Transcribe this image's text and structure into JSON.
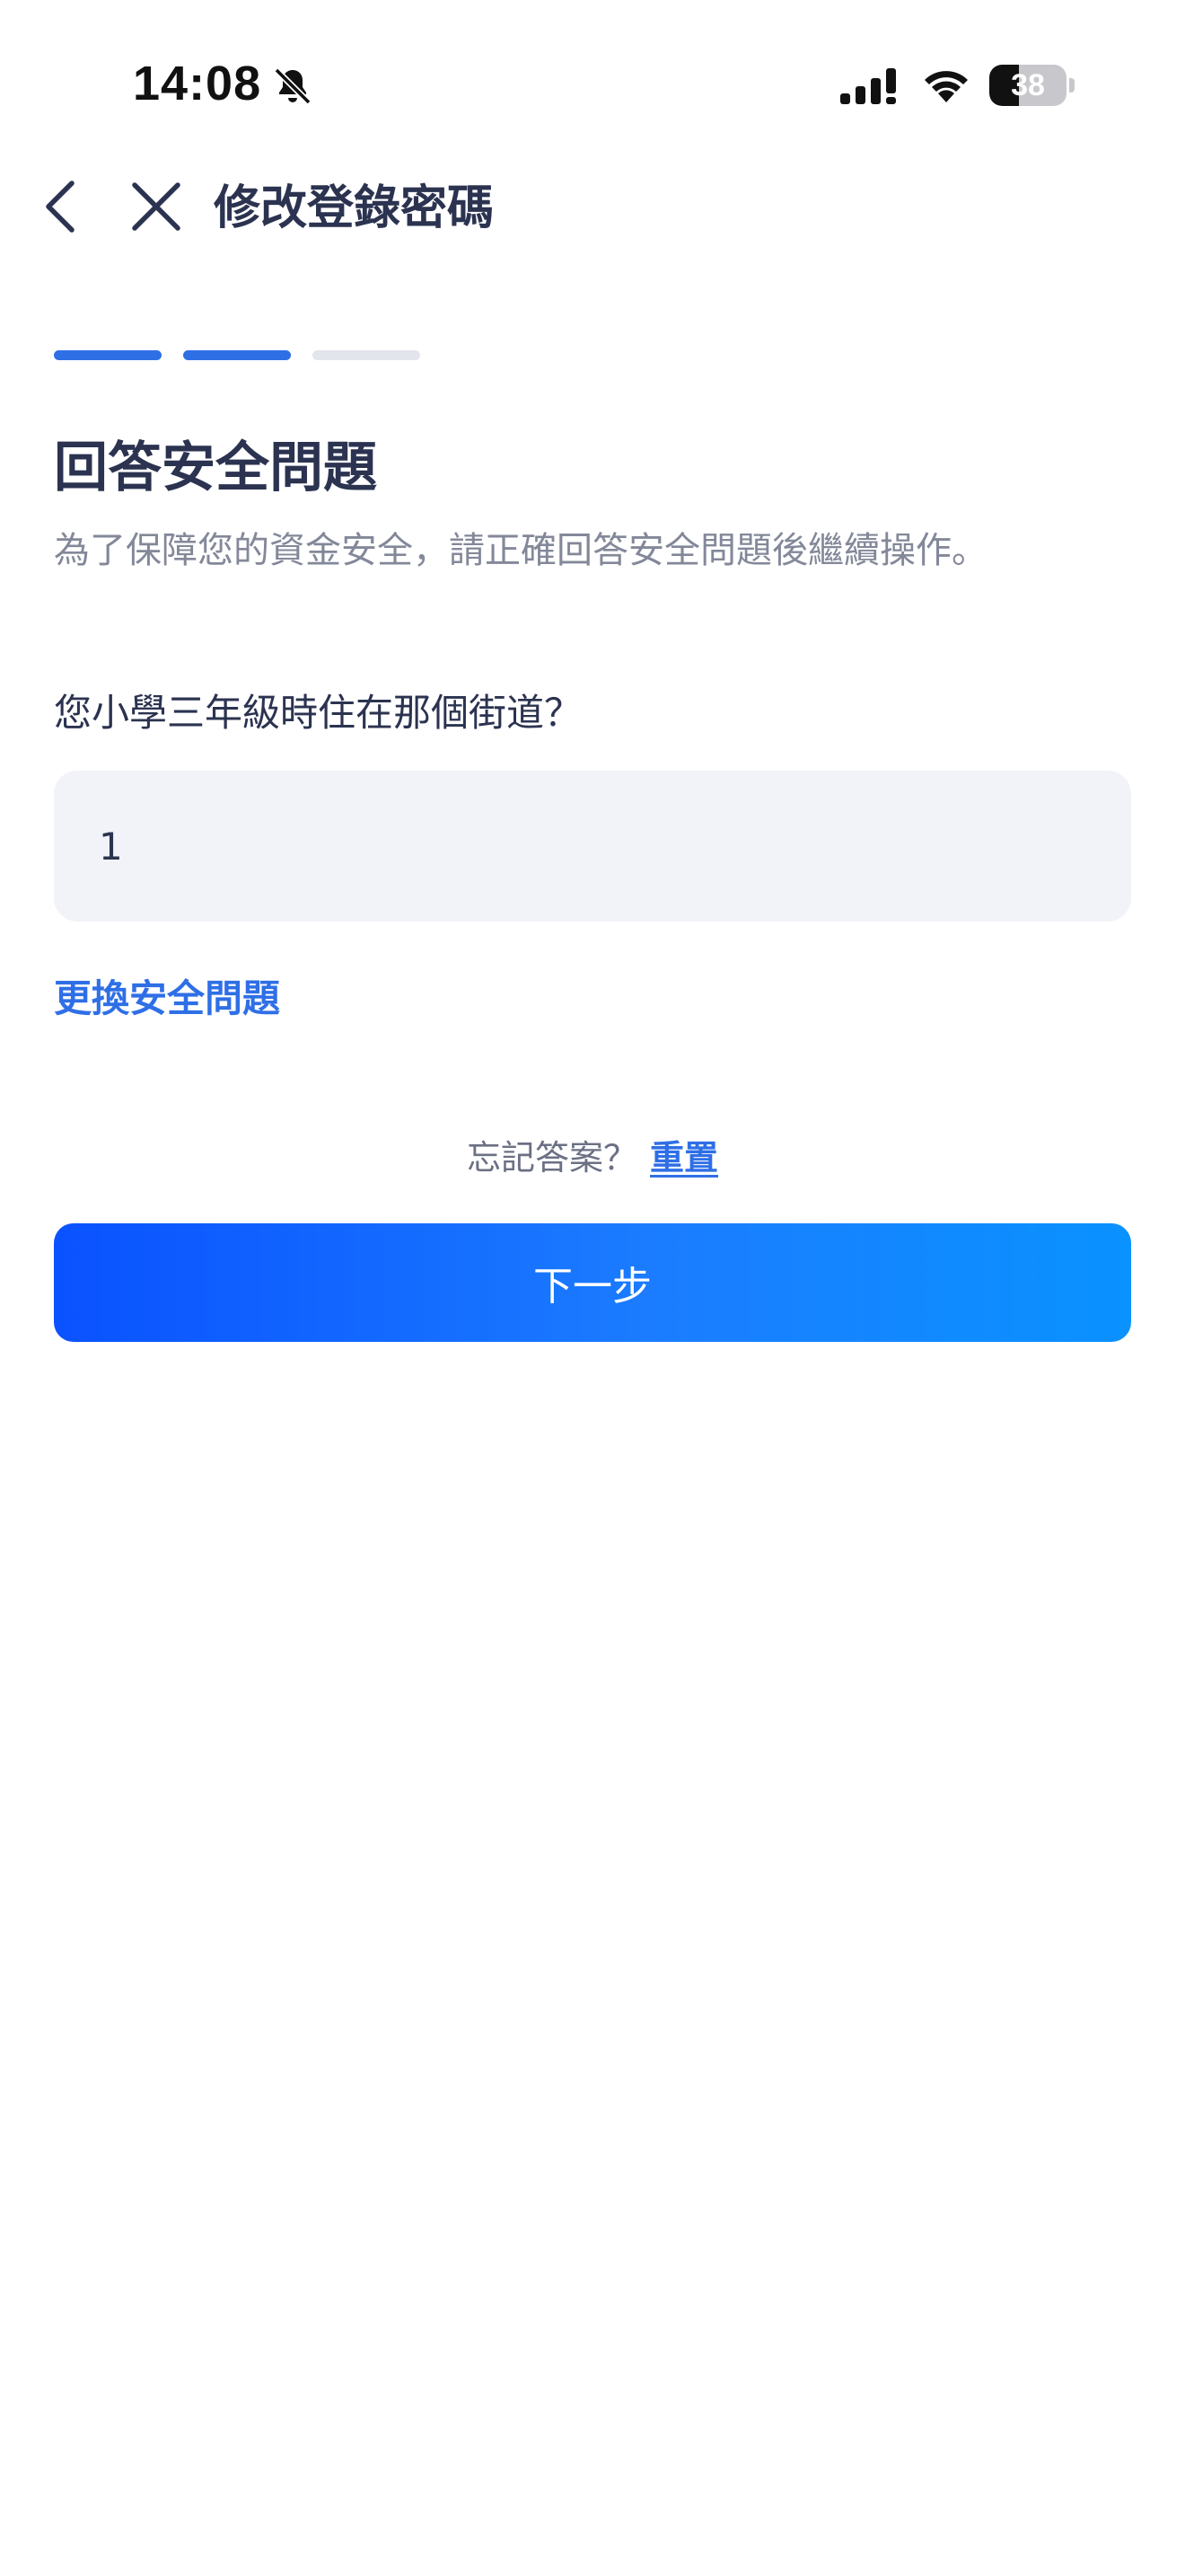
{
  "status_bar": {
    "time": "14:08",
    "battery_level": 38,
    "battery_text": "38",
    "icons": [
      "bell-muted-icon",
      "signal-icon",
      "wifi-icon",
      "battery-icon"
    ]
  },
  "nav": {
    "back_icon": "chevron-left-icon",
    "close_icon": "close-icon",
    "title": "修改登錄密碼"
  },
  "steps": {
    "total": 3,
    "completed": 2,
    "active_color": "#2f6fe6",
    "inactive_color": "#e3e5ec"
  },
  "section": {
    "title": "回答安全問題",
    "description": "為了保障您的資金安全，請正確回答安全問題後繼續操作。"
  },
  "question": {
    "label": "您小學三年級時住在那個街道？",
    "answer_value": "1"
  },
  "links": {
    "change_question": "更換安全問題",
    "forgot_prompt": "忘記答案？",
    "reset": "重置"
  },
  "actions": {
    "next_label": "下一步"
  },
  "colors": {
    "primary": "#2f6fe6",
    "button_gradient_start": "#0a52ff",
    "button_gradient_end": "#0a92ff",
    "text_primary": "#2b3350",
    "text_secondary": "#838899",
    "input_bg": "#f2f3f8"
  }
}
